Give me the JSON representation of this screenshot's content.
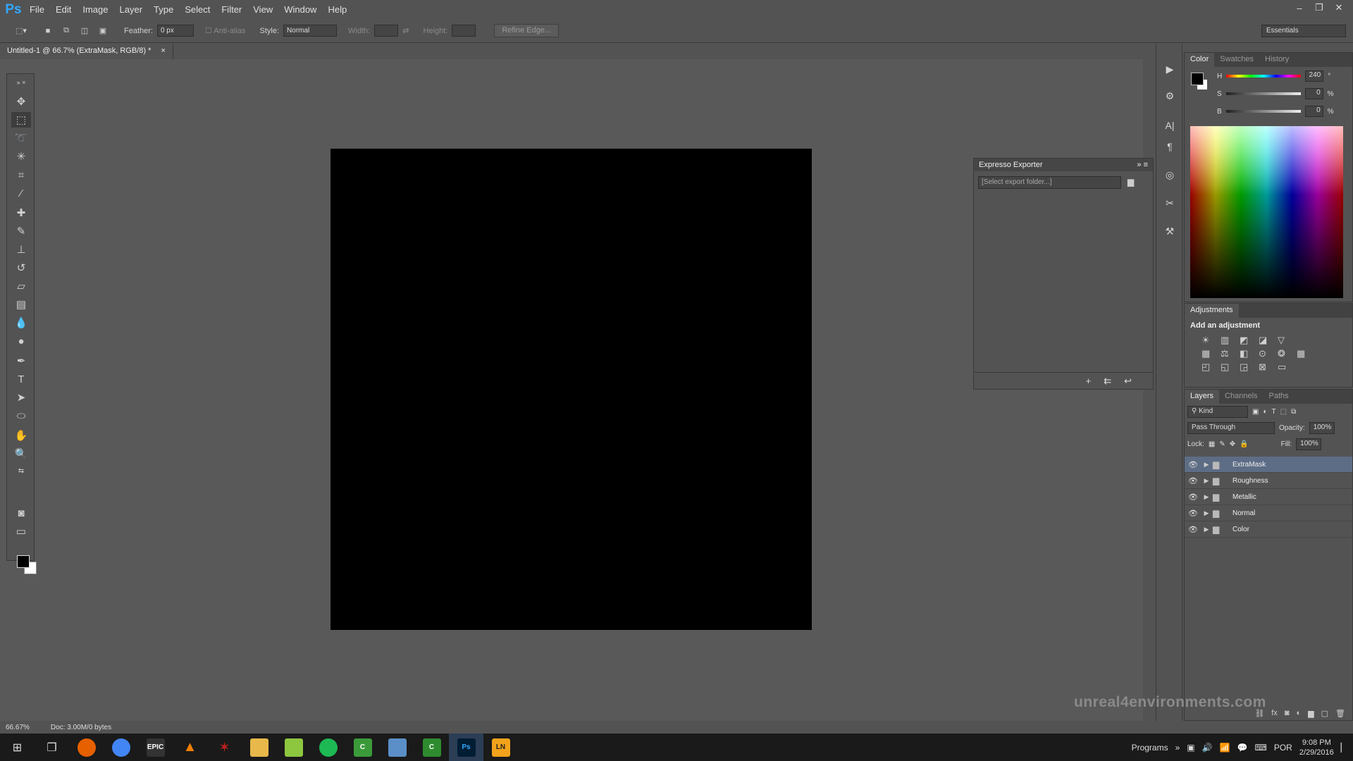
{
  "app": {
    "logo": "Ps"
  },
  "menu": [
    "File",
    "Edit",
    "Image",
    "Layer",
    "Type",
    "Select",
    "Filter",
    "View",
    "Window",
    "Help"
  ],
  "window_controls": {
    "minimize": "–",
    "restore": "❐",
    "close": "✕"
  },
  "options_bar": {
    "feather_label": "Feather:",
    "feather_value": "0 px",
    "antialias_label": "Anti-alias",
    "style_label": "Style:",
    "style_value": "Normal",
    "width_label": "Width:",
    "height_label": "Height:",
    "refine_edge": "Refine Edge...",
    "workspace": "Essentials"
  },
  "document": {
    "tab_title": "Untitled-1 @ 66.7% (ExtraMask, RGB/8) *",
    "close": "×"
  },
  "status": {
    "zoom": "66.67%",
    "doc_size": "Doc: 3.00M/0 bytes"
  },
  "exporter": {
    "title": "Expresso Exporter",
    "placeholder": "[Select export folder...]"
  },
  "color_panel": {
    "tabs": [
      "Color",
      "Swatches",
      "History"
    ],
    "h_label": "H",
    "h_value": "240",
    "h_unit": "°",
    "s_label": "S",
    "s_value": "0",
    "s_unit": "%",
    "b_label": "B",
    "b_value": "0",
    "b_unit": "%"
  },
  "adjustments": {
    "tab": "Adjustments",
    "title": "Add an adjustment"
  },
  "layers_panel": {
    "tabs": [
      "Layers",
      "Channels",
      "Paths"
    ],
    "filter": "Kind",
    "blend_mode": "Pass Through",
    "opacity_label": "Opacity:",
    "opacity_value": "100%",
    "lock_label": "Lock:",
    "fill_label": "Fill:",
    "fill_value": "100%",
    "layers": [
      {
        "name": "ExtraMask",
        "selected": true
      },
      {
        "name": "Roughness",
        "selected": false
      },
      {
        "name": "Metallic",
        "selected": false
      },
      {
        "name": "Normal",
        "selected": false
      },
      {
        "name": "Color",
        "selected": false
      }
    ]
  },
  "watermark": "unreal4environments.com",
  "taskbar": {
    "programs_label": "Programs",
    "language": "POR",
    "time": "9:08 PM",
    "date": "2/29/2016"
  }
}
